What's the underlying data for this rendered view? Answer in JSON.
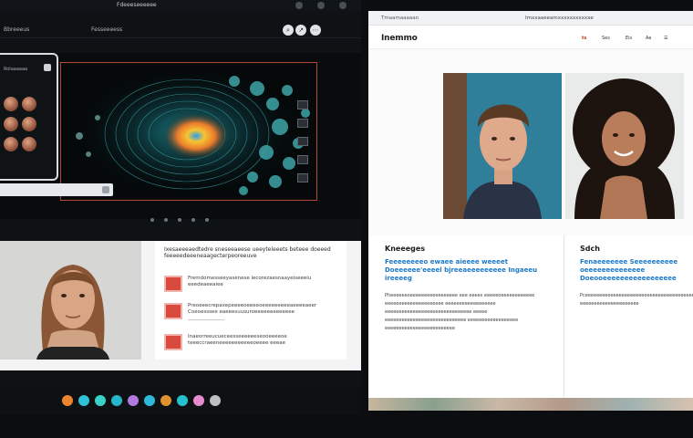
{
  "left": {
    "window_title": "Fdeeeseeeeee",
    "menu": {
      "item1": "Bbreeeus",
      "item2": "Fesseeeess"
    },
    "viewer": {
      "panel_title": "Rolaaaaaa"
    },
    "articles": {
      "heading": "Ixesaeeeaedtedre sneseeaeese ueeyteleeets beteee doeeed feeeeedeeeneaagecterpeoreeuve",
      "items": [
        "Fremdomesseeyasenese iecorezaesnaayeiseeeiu eeedeaeeaiee",
        "Preoeeecrepaxepeeeeoeeeeoeeeeeeeeeaeeeeaeer Coeoesssee eaeeesuusuroeeeeeeeeeeeee",
        "Inaeorreeucueceesseeeeeeseooeeeeoe teeeccraeeneeeeeeeeeeeoeeee eeeae"
      ]
    },
    "dock": {
      "colors": [
        "#e8852e",
        "#2fc2d6",
        "#3ad1c8",
        "#27b5c9",
        "#b07adf",
        "#2fb9d9",
        "#e0902f",
        "#26c1cf",
        "#e78bd0",
        "#bfbfbf"
      ]
    }
  },
  "right": {
    "tab_title": "Tmaamaaaaan",
    "url": "Imxxaaeeamxxxxxxxxxxxe",
    "logo": "Inemmo",
    "nav": [
      "ts",
      "Ses",
      "Eis",
      "Ae"
    ],
    "col1": {
      "kicker": "Kneeeges",
      "headline": "Feeeeeeeeo ewaee aieeee weeeet Doeeeeee'eeeel bjreeaeeeeeeeee Ingaeeu ireeeeg",
      "body": "Pheeeeeeoeeeeeeeeeeeeeeeee eee eeees eeeeeoeeeeeeeeeeee eeeeeeeeeeeeeeeeeeeee eeeeeeeeeeeeeeeeee eeeeeeeeeeeeeeeeeeeeeeeeeeeeeee eeeee eeeeeeeeeeeeeeeeeeeeeeeeeeeee eeeeeeeeeeeeeeeeee eeeeeeeeeeeeeeeeeeeeeeeee"
    },
    "col2": {
      "kicker": "Sdch",
      "headline": "Fenaeeeeeee Seeeeeeeeee oeeeeeeeeeeeeee Doeooeeeeeeeeeeeeeeeee",
      "body": "Pceeeeeeeeeeeeeeeeeeeeeeeeeeeeeeeeeeeeeeeeeeeeeeeeeeeeeeeeeeeeeeeeeeeeeeeeeeeeeeeeeeeeeeeeeeeeeee eeeeeeeeeeeeeeeeeeeee"
    }
  }
}
